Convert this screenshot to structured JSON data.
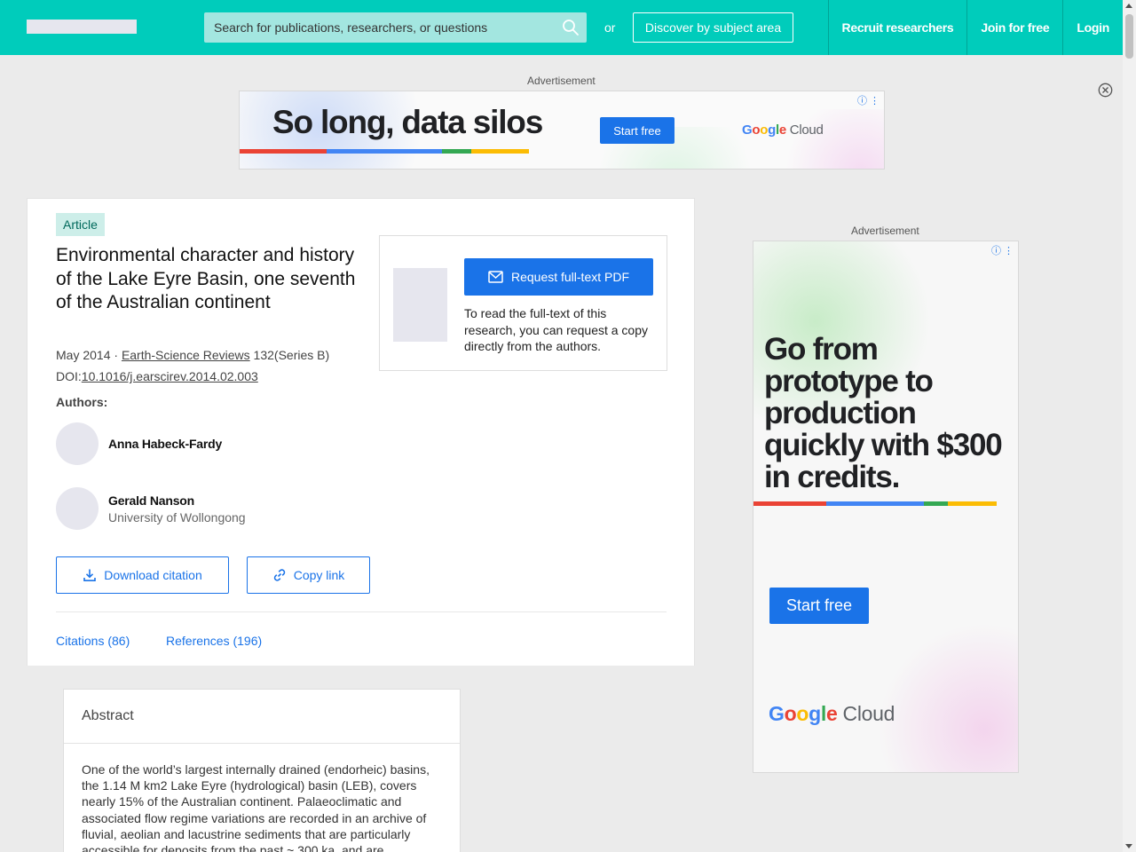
{
  "header": {
    "search_placeholder": "Search for publications, researchers, or questions",
    "or_label": "or",
    "discover_label": "Discover by subject area",
    "nav": [
      "Recruit researchers",
      "Join for free",
      "Login"
    ]
  },
  "ads": {
    "label_top": "Advertisement",
    "label_side": "Advertisement",
    "top": {
      "headline": "So long, data silos",
      "cta": "Start free",
      "brand_google": "Google",
      "brand_cloud": "Cloud"
    },
    "side": {
      "headline": "Go from prototype to production quickly with $300 in credits.",
      "cta": "Start free",
      "brand_google": "Google",
      "brand_cloud": "Cloud"
    },
    "info_glyph": "ⓘ ⋮"
  },
  "article": {
    "type_badge": "Article",
    "title": "Environmental character and history of the Lake Eyre Basin, one seventh of the Australian continent",
    "date": "May 2014 · ",
    "journal": "Earth-Science Reviews",
    "volume": " 132(Series B)",
    "doi_prefix": "DOI:",
    "doi": "10.1016/j.earscirev.2014.02.003",
    "authors_label": "Authors:",
    "authors": [
      {
        "name": "Anna Habeck-Fardy",
        "institution": ""
      },
      {
        "name": "Gerald Nanson",
        "institution": "University of Wollongong"
      }
    ],
    "download_citation": "Download citation",
    "copy_link": "Copy link",
    "tabs": [
      "Citations (86)",
      "References (196)"
    ]
  },
  "fulltext": {
    "button": "Request full-text PDF",
    "description": "To read the full-text of this research, you can request a copy directly from the authors."
  },
  "abstract": {
    "heading": "Abstract",
    "text": "One of the world’s largest internally drained (endorheic) basins, the 1.14 M km2 Lake Eyre (hydrological) basin (LEB), covers nearly 15% of the Australian continent. Palaeoclimatic and associated flow regime variations are recorded in an archive of fluvial, aeolian and lacustrine sediments that are particularly accessible for deposits from the past ~ 300 ka, and are"
  },
  "colors": {
    "brand_teal": "#00ccbb",
    "link_blue": "#1a73e8",
    "google_red": "#ea4335",
    "google_blue": "#4285f4",
    "google_green": "#34a853",
    "google_yellow": "#fbbc04"
  }
}
